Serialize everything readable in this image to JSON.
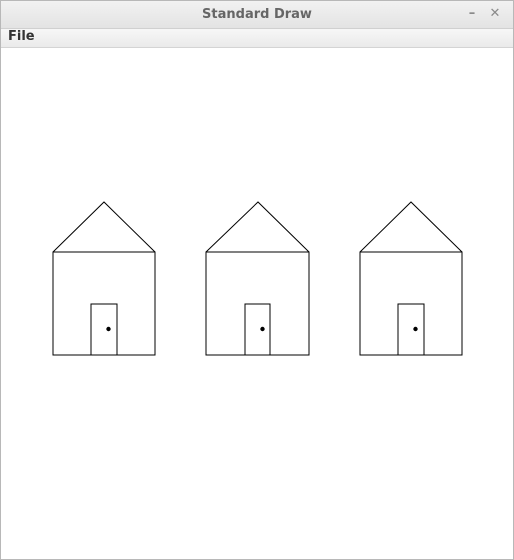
{
  "window": {
    "title": "Standard Draw",
    "minimize_glyph": "–",
    "close_glyph": "✕"
  },
  "menubar": {
    "file_label": "File"
  },
  "canvas": {
    "background": "#ffffff",
    "stroke_color": "#000000",
    "shapes": [
      "house",
      "house",
      "house"
    ]
  }
}
